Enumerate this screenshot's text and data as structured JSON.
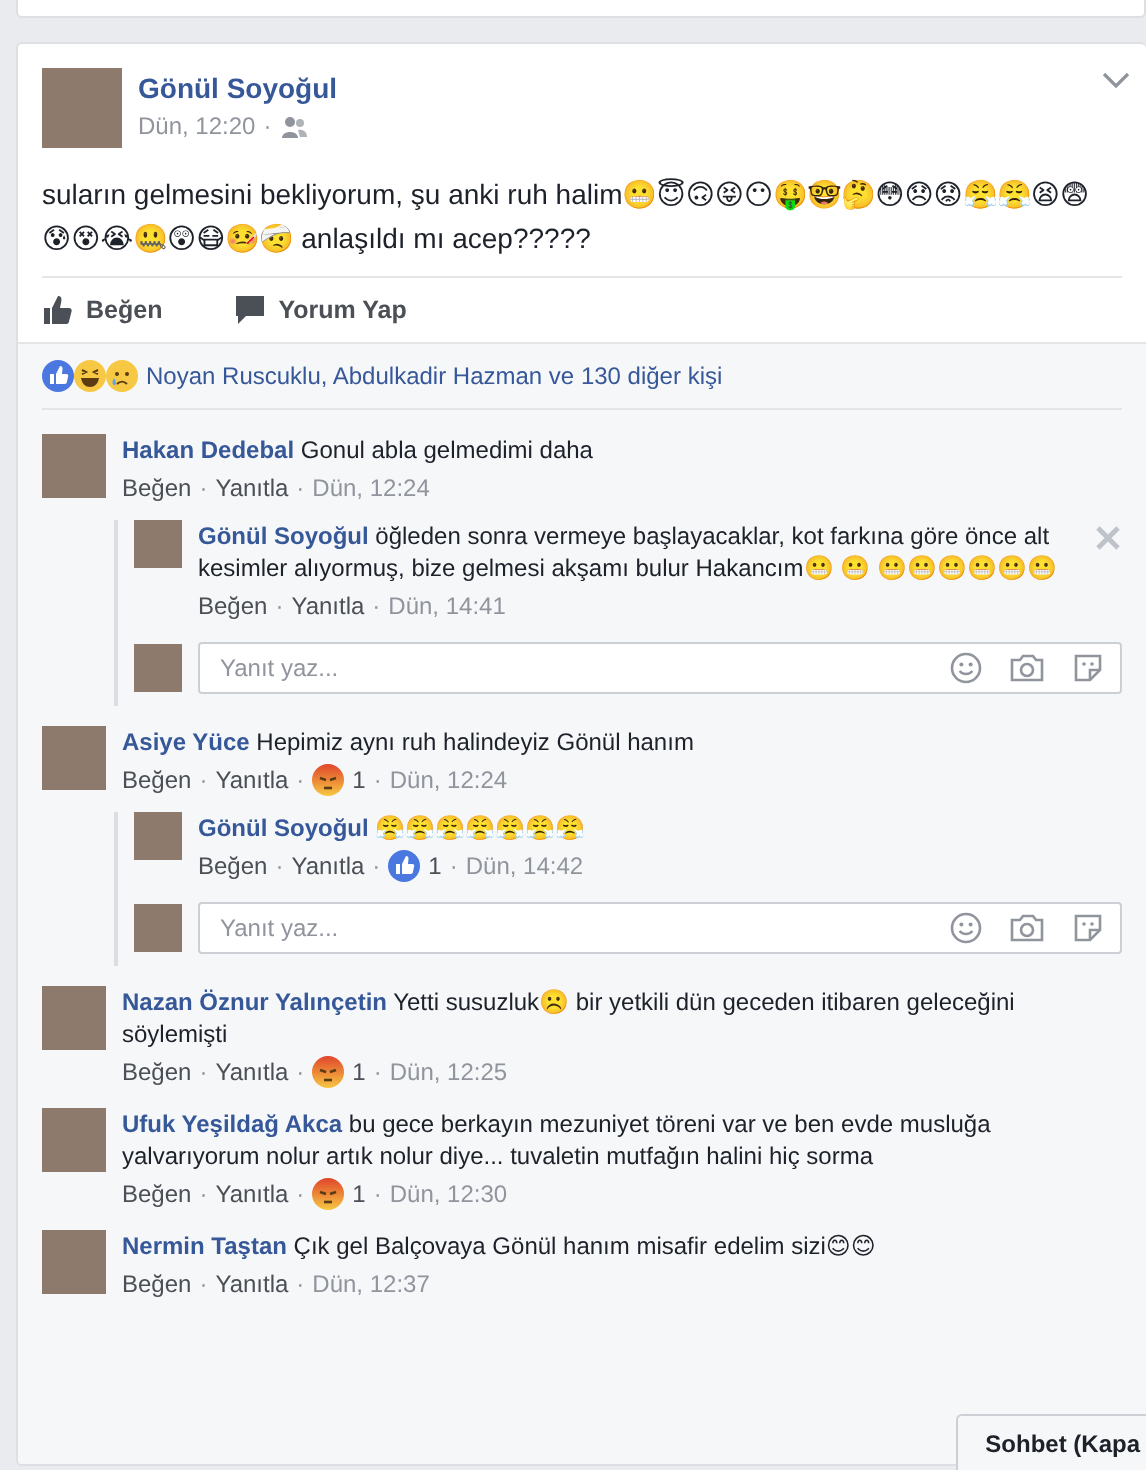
{
  "post": {
    "author": "Gönül Soyoğul",
    "time": "Dün, 12:20",
    "separator": "·",
    "text": "suların gelmesini bekliyorum, şu anki ruh halim😬😇🙃😝😶🤑🤓🤔😳😞😟😤😤😫😨😰😵😭🤐😲😷🤒🤕 anlaşıldı mı acep?????",
    "actions": [
      {
        "kind": "like",
        "label": "Beğen"
      },
      {
        "kind": "comment",
        "label": "Yorum Yap"
      }
    ],
    "reactions": {
      "icons": [
        {
          "kind": "like"
        },
        {
          "kind": "haha"
        },
        {
          "kind": "sad"
        }
      ],
      "text": "Noyan Ruscuklu, Abdulkadir Hazman ve 130 diğer kişi"
    }
  },
  "comments": [
    {
      "author": "Hakan Dedebal",
      "text": "Gonul abla gelmedimi daha",
      "separator": "·",
      "like": "Beğen",
      "reply": "Yanıtla",
      "time": "Dün, 12:24",
      "replies": [
        {
          "author": "Gönül Soyoğul",
          "text": "öğleden sonra vermeye başlayacaklar, kot farkına göre önce alt kesimler alıyormuş, bize gelmesi akşamı bulur Hakancım😬 😬 😬😬😬😬😬😬",
          "separator": "·",
          "like": "Beğen",
          "reply": "Yanıtla",
          "time": "Dün, 14:41",
          "hovered": true
        }
      ],
      "reply_box": {
        "placeholder": "Yanıt yaz..."
      }
    },
    {
      "author": "Asiye Yüce",
      "text": "Hepimiz aynı ruh halindeyiz Gönül hanım",
      "separator": "·",
      "like": "Beğen",
      "reply": "Yanıtla",
      "reaction": {
        "kind": "angry",
        "count": "1"
      },
      "time": "Dün, 12:24",
      "replies": [
        {
          "author": "Gönül Soyoğul",
          "text": "😤😤😤😤😤😤😤",
          "separator": "·",
          "like": "Beğen",
          "reply": "Yanıtla",
          "reaction": {
            "kind": "like",
            "count": "1"
          },
          "time": "Dün, 14:42",
          "hovered": false
        }
      ],
      "reply_box": {
        "placeholder": "Yanıt yaz..."
      }
    },
    {
      "author": "Nazan Öznur Yalınçetin",
      "text": "Yetti susuzluk☹️ bir yetkili dün geceden itibaren geleceğini söylemişti",
      "separator": "·",
      "like": "Beğen",
      "reply": "Yanıtla",
      "reaction": {
        "kind": "angry",
        "count": "1"
      },
      "time": "Dün, 12:25"
    },
    {
      "author": "Ufuk Yeşildağ Akca",
      "text": "bu gece berkayın mezuniyet töreni var ve ben evde musluğa yalvarıyorum nolur artık nolur diye... tuvaletin mutfağın halini hiç sorma",
      "separator": "·",
      "like": "Beğen",
      "reply": "Yanıtla",
      "reaction": {
        "kind": "angry",
        "count": "1"
      },
      "time": "Dün, 12:30"
    },
    {
      "author": "Nermin Taştan",
      "text": "Çık gel Balçovaya Gönül hanım misafir edelim sizi😊😊",
      "separator": "·",
      "like": "Beğen",
      "reply": "Yanıtla",
      "time": "Dün, 12:37"
    }
  ],
  "chat_tab": {
    "label": "Sohbet (Kapa"
  }
}
